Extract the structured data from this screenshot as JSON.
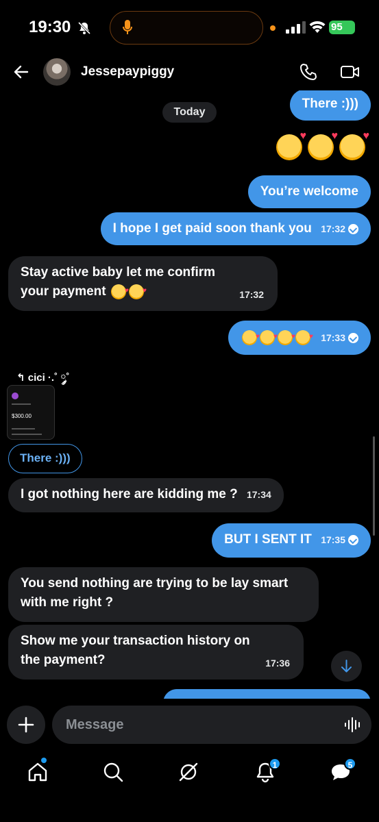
{
  "status_bar": {
    "time": "19:30",
    "battery": "95"
  },
  "header": {
    "contact_name": "Jessepaypiggy"
  },
  "chat": {
    "date_divider": "Today",
    "messages": [
      {
        "dir": "out",
        "text": "There :)))"
      },
      {
        "dir": "out",
        "text": "You’re welcome"
      },
      {
        "dir": "out",
        "text": "I hope I get paid soon thank you",
        "time": "17:32"
      },
      {
        "dir": "in",
        "text": "Stay active baby let me confirm your payment",
        "time": "17:32"
      },
      {
        "dir": "out",
        "text": "",
        "time": "17:33"
      },
      {
        "dir": "in",
        "text": "I got nothing here are kidding me ?",
        "time": "17:34"
      },
      {
        "dir": "out",
        "text": "BUT I SENT IT",
        "time": "17:35"
      },
      {
        "dir": "in",
        "text": "You send nothing are trying to be lay smart with me right ?"
      },
      {
        "dir": "in",
        "text": "Show me your transaction history on the payment?",
        "time": "17:36"
      }
    ],
    "reply_label": "cici ·.˚ ༘˚",
    "reply_quote": "There :)))",
    "attachment": {
      "amount": "$300.00"
    }
  },
  "composer": {
    "placeholder": "Message"
  },
  "tabbar": {
    "notifications_badge": "1",
    "messages_badge": "5"
  }
}
